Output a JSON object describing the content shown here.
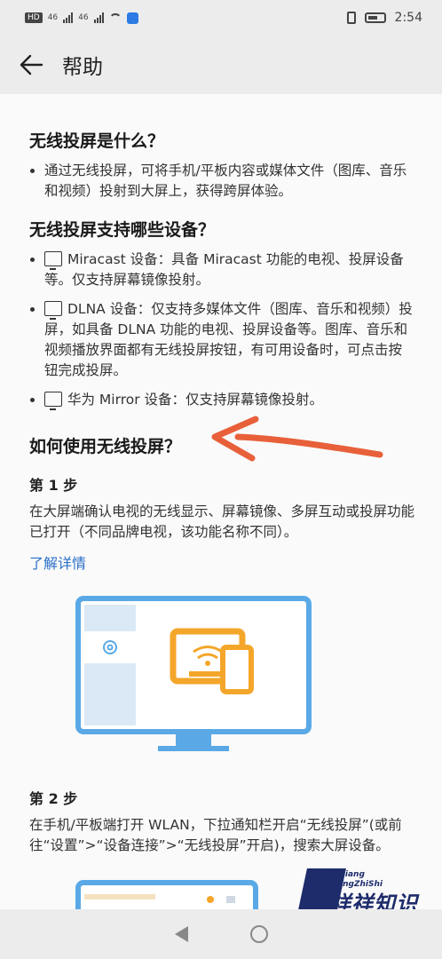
{
  "status_bar": {
    "hd_label": "HD",
    "signal1_label": "46",
    "signal2_label": "46",
    "time": "2:54"
  },
  "header": {
    "title": "帮助"
  },
  "sections": {
    "what": {
      "heading": "无线投屏是什么？",
      "bullet": "通过无线投屏，可将手机/平板内容或媒体文件（图库、音乐和视频）投射到大屏上，获得跨屏体验。"
    },
    "devices": {
      "heading": "无线投屏支持哪些设备？",
      "items": [
        {
          "text": "Miracast 设备：具备 Miracast 功能的电视、投屏设备等。仅支持屏幕镜像投射。",
          "icon": "miracast-icon"
        },
        {
          "text": "DLNA 设备：仅支持多媒体文件（图库、音乐和视频）投屏，如具备 DLNA 功能的电视、投屏设备等。图库、音乐和视频播放界面都有无线投屏按钮，有可用设备时，可点击按钮完成投屏。",
          "icon": "dlna-icon"
        },
        {
          "text": "华为 Mirror 设备：仅支持屏幕镜像投射。",
          "icon": "mirror-icon"
        }
      ]
    },
    "howto": {
      "heading": "如何使用无线投屏？",
      "step1": {
        "title": "第 1 步",
        "text": "在大屏端确认电视的无线显示、屏幕镜像、多屏互动或投屏功能已打开（不同品牌电视，该功能名称不同）。",
        "link": "了解详情"
      },
      "step2": {
        "title": "第 2 步",
        "text": "在手机/平板端打开 WLAN，下拉通知栏开启“无线投屏”(或前往“设置”>“设备连接”>“无线投屏”开启)，搜索大屏设备。"
      }
    }
  },
  "watermark": {
    "small_line1": "YuXiang",
    "small_line2": "XiangZhiShi",
    "big": "誉祥祥知识"
  },
  "colors": {
    "link": "#2a6fc9",
    "illustration_blue": "#5aa9e6",
    "illustration_orange": "#f4a62a",
    "annotation_arrow": "#e8603a",
    "watermark": "#1e2c6b"
  }
}
